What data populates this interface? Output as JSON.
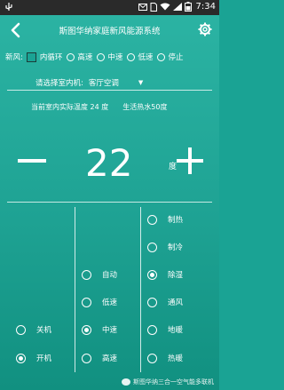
{
  "statusbar": {
    "time": "7:34"
  },
  "header": {
    "title": "斯图华纳家庭新风能源系统"
  },
  "fan": {
    "label": "新风:",
    "options": [
      "内循环",
      "高速",
      "中速",
      "低速",
      "停止"
    ]
  },
  "room": {
    "label": "请选择室内机:",
    "value": "客厅空调"
  },
  "info": {
    "indoor_temp": "当前室内实际温度 24 度",
    "hot_water": "生活热水50度"
  },
  "temperature": {
    "minus": "−",
    "value": "22",
    "unit": "度",
    "plus": "+"
  },
  "power": {
    "items": [
      {
        "label": "关机",
        "selected": false
      },
      {
        "label": "开机",
        "selected": true
      }
    ]
  },
  "speed": {
    "items": [
      {
        "label": "自动",
        "selected": false
      },
      {
        "label": "低速",
        "selected": false
      },
      {
        "label": "中速",
        "selected": true
      },
      {
        "label": "高速",
        "selected": false
      }
    ]
  },
  "mode": {
    "items": [
      {
        "label": "制热",
        "selected": false
      },
      {
        "label": "制冷",
        "selected": false
      },
      {
        "label": "除湿",
        "selected": true
      },
      {
        "label": "通风",
        "selected": false
      },
      {
        "label": "地暖",
        "selected": false
      },
      {
        "label": "热暖",
        "selected": false
      }
    ]
  },
  "footer": {
    "text": "斯图华纳三合一空气能多联机"
  }
}
